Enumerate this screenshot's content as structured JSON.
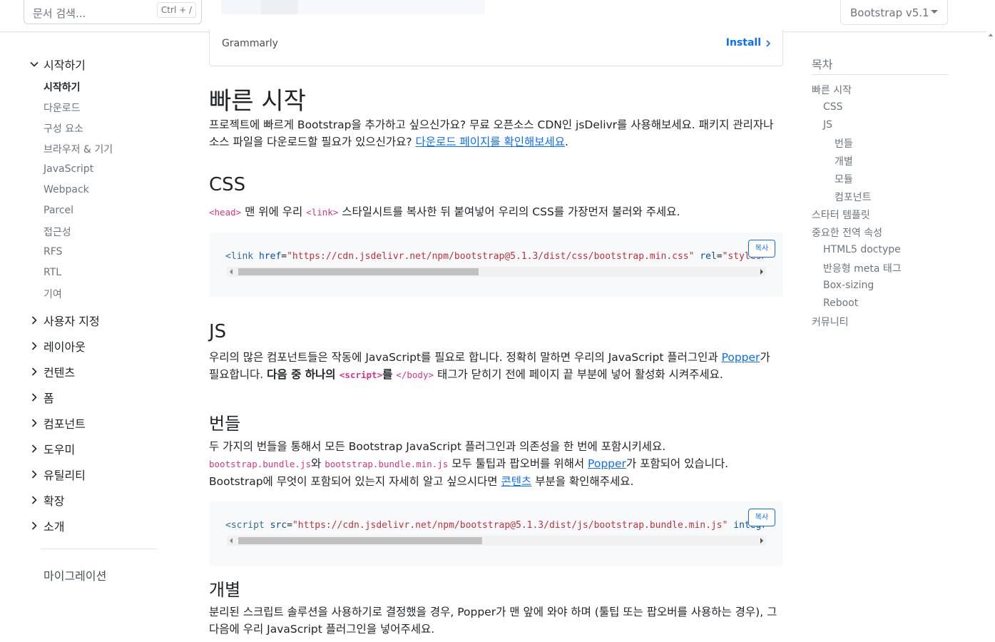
{
  "header": {
    "search_placeholder": "문서 검색...",
    "search_shortcut": "Ctrl + /",
    "version_label": "Bootstrap v5.1"
  },
  "sidebar": {
    "groups": [
      {
        "label": "시작하기",
        "expanded": true
      },
      {
        "label": "사용자 지정"
      },
      {
        "label": "레이아웃"
      },
      {
        "label": "컨텐츠"
      },
      {
        "label": "폼"
      },
      {
        "label": "컴포넌트"
      },
      {
        "label": "도우미"
      },
      {
        "label": "유틸리티"
      },
      {
        "label": "확장"
      },
      {
        "label": "소개"
      }
    ],
    "getting_started_items": [
      {
        "label": "시작하기",
        "active": true
      },
      {
        "label": "다운로드"
      },
      {
        "label": "구성 요소"
      },
      {
        "label": "브라우저 & 기기"
      },
      {
        "label": "JavaScript"
      },
      {
        "label": "Webpack"
      },
      {
        "label": "Parcel"
      },
      {
        "label": "접근성"
      },
      {
        "label": "RFS"
      },
      {
        "label": "RTL"
      },
      {
        "label": "기여"
      }
    ],
    "migration_label": "마이그레이션"
  },
  "ad": {
    "name": "Grammarly",
    "install_label": "Install"
  },
  "main": {
    "quickstart": {
      "title": "빠른 시작",
      "text": "프로젝트에 빠르게 Bootstrap을 추가하고 싶으신가요? 무료 오픈소스 CDN인 jsDelivr를 사용해보세요. 패키지 관리자나 소스 파일을 다운로드할 필요가 있으신가요? ",
      "link": "다운로드 페이지를 확인해보세요",
      "end": "."
    },
    "css": {
      "title": "CSS",
      "code_head": "<head>",
      "text1": " 맨 위에 우리 ",
      "code_link": "<link>",
      "text2": " 스타일시트를 복사한 뒤 붙여넣어 우리의 CSS를 가장먼저 불러와 주세요.",
      "snippet": {
        "tag_open": "<link",
        "attr1": "href",
        "val1": "\"https://cdn.jsdelivr.net/npm/bootstrap@5.1.3/dist/css/bootstrap.min.css\"",
        "attr2": "rel",
        "val2": "\"stylesheet\""
      },
      "copy_label": "복사"
    },
    "js": {
      "title": "JS",
      "text1": "우리의 많은 컴포넌트들은 작동에 JavaScript를 필요로 합니다. 정확히 말하면 우리의 JavaScript 플러그인과 ",
      "popper_link": "Popper",
      "text2": "가 필요합니다. ",
      "bold": "다음 중 하나의 ",
      "code_script": "<script>",
      "bold_end": "를",
      "text3": " ",
      "code_body": "</body>",
      "text4": " 태그가 닫히기 전에 페이지 끝 부분에 넣어 활성화 시켜주세요."
    },
    "bundle": {
      "title": "번들",
      "text1": "두 가지의 번들을 통해서 모든 Bootstrap JavaScript 플러그인과 의존성을 한 번에 포함시키세요.",
      "code1": "bootstrap.bundle.js",
      "text2": "와 ",
      "code2": "bootstrap.bundle.min.js",
      "text3": " 모두 툴팁과 팝오버를 위해서 ",
      "popper_link": "Popper",
      "text4": "가 포함되어 있습니다. Bootstrap에 무엇이 포함되어 있는지 자세히 알고 싶으시다면 ",
      "contents_link": "콘텐츠",
      "text5": " 부분을 확인해주세요.",
      "snippet": {
        "tag_open": "<script",
        "attr1": "src",
        "val1": "\"https://cdn.jsdelivr.net/npm/bootstrap@5.1.3/dist/js/bootstrap.bundle.min.js\"",
        "attr2": "integrity",
        "val2": "\"\""
      },
      "copy_label": "복사"
    },
    "separate": {
      "title": "개별",
      "text": "분리된 스크립트 솔루션을 사용하기로 결정했을 경우, Popper가 맨 앞에 와야 하며 (툴팁 또는 팝오버를 사용하는 경우), 그 다음에 우리 JavaScript 플러그인을 넣어주세요."
    }
  },
  "toc": {
    "title": "목차",
    "items": [
      {
        "label": "빠른 시작",
        "level": 0
      },
      {
        "label": "CSS",
        "level": 1
      },
      {
        "label": "JS",
        "level": 1
      },
      {
        "label": "번들",
        "level": 2
      },
      {
        "label": "개별",
        "level": 2
      },
      {
        "label": "모듈",
        "level": 2
      },
      {
        "label": "컴포넌트",
        "level": 2
      },
      {
        "label": "스타터 템플릿",
        "level": 0
      },
      {
        "label": "중요한 전역 속성",
        "level": 0
      },
      {
        "label": "HTML5 doctype",
        "level": 1
      },
      {
        "label": "반응형 meta 태그",
        "level": 1
      },
      {
        "label": "Box-sizing",
        "level": 1
      },
      {
        "label": "Reboot",
        "level": 1
      },
      {
        "label": "커뮤니티",
        "level": 0
      }
    ]
  }
}
